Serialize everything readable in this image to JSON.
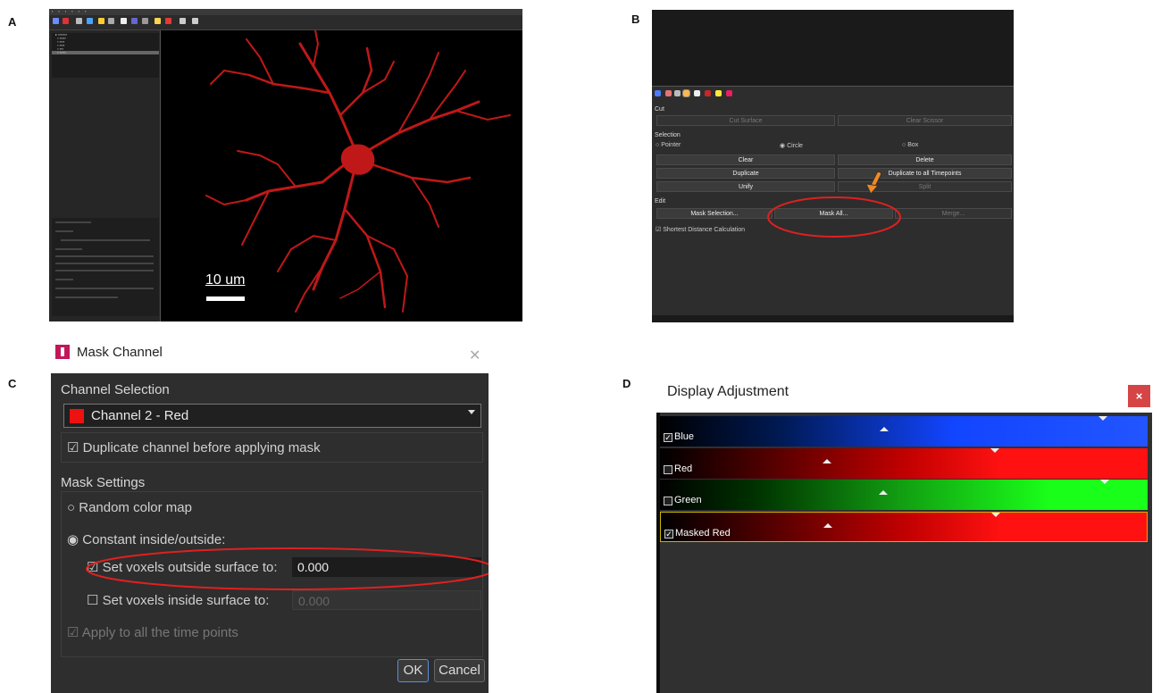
{
  "labels": {
    "a": "A",
    "b": "B",
    "c": "C",
    "d": "D"
  },
  "panel_a": {
    "scale_text": "10 um"
  },
  "panel_b": {
    "cut_section": "Cut",
    "cut_surface": "Cut Surface",
    "clear_scissor": "Clear Scissor",
    "selection_section": "Selection",
    "radio_pointer": "Pointer",
    "radio_circle": "Circle",
    "radio_box": "Box",
    "clear": "Clear",
    "delete": "Delete",
    "duplicate": "Duplicate",
    "duplicate_all": "Duplicate to all Timepoints",
    "unify": "Unify",
    "split": "Split",
    "edit_section": "Edit",
    "mask_selection": "Mask Selection...",
    "mask_all": "Mask All...",
    "merge": "Merge...",
    "shortest_distance": "Shortest Distance Calculation"
  },
  "panel_c": {
    "title": "Mask Channel",
    "channel_selection": "Channel Selection",
    "channel_value": "Channel 2 - Red",
    "channel_color": "#ee1111",
    "duplicate_before": "Duplicate channel before applying mask",
    "mask_settings": "Mask Settings",
    "random_color_map": "Random color map",
    "constant_inside_outside": "Constant inside/outside:",
    "set_outside": "Set voxels outside surface to:",
    "outside_value": "0.000",
    "set_inside": "Set voxels inside surface to:",
    "inside_value": "0.000",
    "apply_all": "Apply to all the time points",
    "ok": "OK",
    "cancel": "Cancel"
  },
  "panel_d": {
    "title": "Display Adjustment",
    "close": "×",
    "channels": [
      {
        "name": "Blue",
        "checked": true,
        "color": "#1a4cff"
      },
      {
        "name": "Red",
        "checked": false,
        "color": "#ff1111"
      },
      {
        "name": "Green",
        "checked": false,
        "color": "#1aff1a"
      },
      {
        "name": "Masked Red",
        "checked": true,
        "color": "#ff1111"
      }
    ]
  },
  "colors": {
    "highlight": "#e02020",
    "arrow": "#f08a24"
  }
}
